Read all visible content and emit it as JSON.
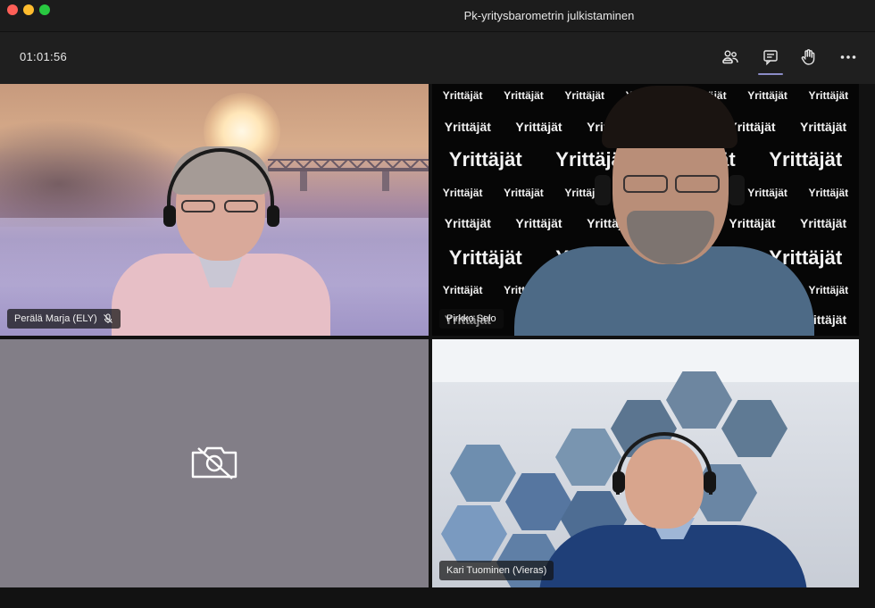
{
  "window": {
    "title": "Pk-yritysbarometrin julkistaminen"
  },
  "toolbar": {
    "timer": "01:01:56",
    "buttons": [
      {
        "name": "people",
        "icon": "people-icon"
      },
      {
        "name": "chat",
        "icon": "chat-icon",
        "active": true
      },
      {
        "name": "raise-hand",
        "icon": "hand-icon"
      },
      {
        "name": "more",
        "icon": "more-icon"
      }
    ]
  },
  "participants": [
    {
      "name": "Perälä Marja (ELY)",
      "muted": true,
      "video": true
    },
    {
      "name": "Pirkko Selo",
      "muted": false,
      "video": true
    },
    {
      "name": "",
      "muted": false,
      "video": false
    },
    {
      "name": "Kari Tuominen (Vieras)",
      "muted": false,
      "video": true
    }
  ],
  "backdrop": {
    "brand": "Yrittäjät"
  },
  "colors": {
    "accent": "#8b8cc7",
    "window_bg": "#1f1f1f",
    "camera_off_tile": "#827e87"
  }
}
